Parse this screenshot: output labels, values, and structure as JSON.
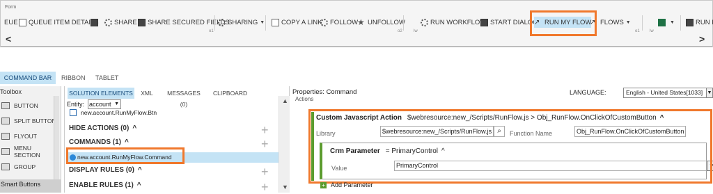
{
  "ribbon": {
    "form_label": "Form",
    "buttons": [
      {
        "label": "EUE",
        "icon": "queue-icon"
      },
      {
        "label": "QUEUE ITEM DETAILS",
        "icon": "document-icon"
      },
      {
        "label": "",
        "icon": "assign-icon"
      },
      {
        "label": "SHARE",
        "icon": "share-gear-icon"
      },
      {
        "label": "SHARE SECURED FIELDS",
        "icon": "secured-fields-icon"
      },
      {
        "label": "SHARING",
        "icon": "sharing-gear-icon"
      },
      {
        "label": "COPY A LINK",
        "icon": "copy-link-icon"
      },
      {
        "label": "FOLLOW",
        "icon": "follow-icon"
      },
      {
        "label": "UNFOLLOW",
        "icon": "unfollow-icon"
      },
      {
        "label": "RUN WORKFLOW",
        "icon": "workflow-icon"
      },
      {
        "label": "START DIALOG",
        "icon": "dialog-icon"
      },
      {
        "label": "RUN MY FLOW",
        "icon": "flow-icon"
      },
      {
        "label": "FLOWS",
        "icon": "flows-icon"
      },
      {
        "label": "",
        "icon": "excel-icon"
      },
      {
        "label": "RUN R",
        "icon": "run-report-icon"
      }
    ],
    "group_labels": [
      "o1",
      "o2",
      "lw",
      "o1",
      "lw"
    ]
  },
  "tabs": [
    "COMMAND BAR",
    "RIBBON",
    "TABLET"
  ],
  "toolbox": {
    "title": "Toolbox",
    "items": [
      "BUTTON",
      "SPLIT BUTTON",
      "FLYOUT",
      "MENU SECTION",
      "GROUP"
    ],
    "footer": "Smart Buttons"
  },
  "middle": {
    "tabs": [
      "SOLUTION ELEMENTS",
      "XML",
      "MESSAGES (0)",
      "CLIPBOARD"
    ],
    "entity_label": "Entity:",
    "entity_value": "account",
    "button_item": "new.account.RunMyFlow.Btn",
    "sections": [
      "HIDE ACTIONS (0)",
      "COMMANDS (1)",
      "DISPLAY RULES (0)",
      "ENABLE RULES (1)"
    ],
    "command_item": "new.account.RunMyFlow.Command"
  },
  "properties": {
    "title": "Properties: Command",
    "actions_label": "Actions",
    "language_label": "LANGUAGE:",
    "language_value": "English - United States[1033]",
    "action_title": "Custom Javascript Action",
    "action_summary": "$webresource:new_/Scripts/RunFlow.js > Obj_RunFlow.OnClickOfCustomButton",
    "library_label": "Library",
    "library_value": "$webresource:new_/Scripts/RunFlow.js",
    "function_label": "Function Name",
    "function_value": "Obj_RunFlow.OnClickOfCustomButton",
    "param_title": "Crm Parameter",
    "param_summary": "= PrimaryControl",
    "value_label": "Value",
    "value_value": "PrimaryControl",
    "add_parameter": "Add Parameter"
  },
  "colors": {
    "highlight_border": "#f0782c",
    "selected_bg": "#c4e3f5",
    "action_accent": "#5c9c2f"
  }
}
